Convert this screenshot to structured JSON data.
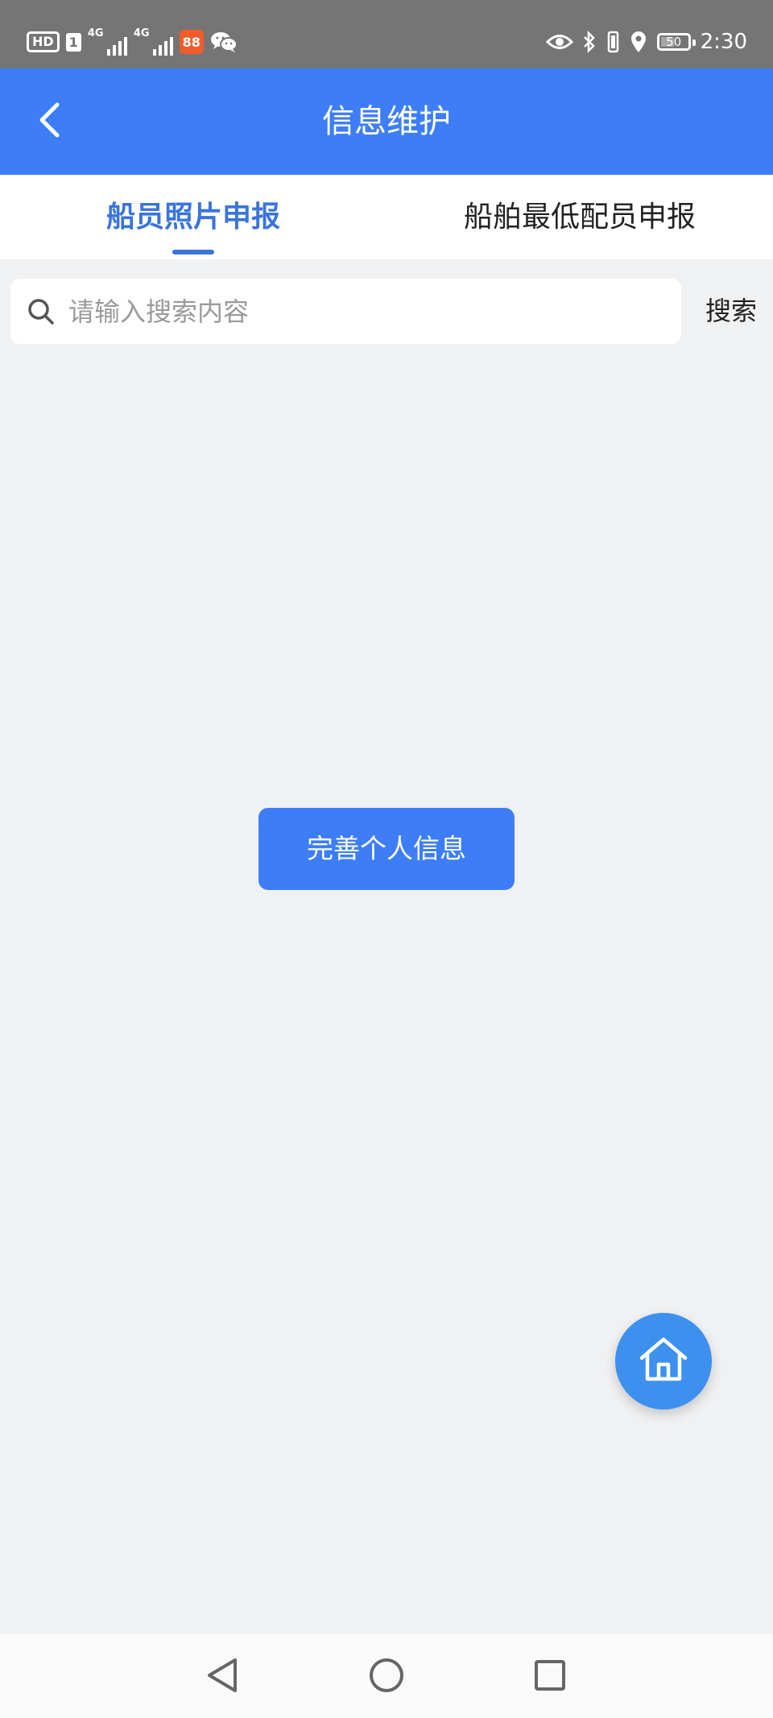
{
  "status_bar": {
    "hd_badge": "HD",
    "sim_badge": "1",
    "network_1": "4G",
    "network_2": "4G",
    "app_badge": "88",
    "battery_level": "50",
    "battery_level_fraction": 0.5,
    "clock": "2:30",
    "icons": [
      "eye-icon",
      "bluetooth-icon",
      "vibrate-icon",
      "location-icon"
    ]
  },
  "header": {
    "title": "信息维护",
    "back_icon": "chevron-left-icon"
  },
  "tabs": [
    {
      "label": "船员照片申报",
      "active": true
    },
    {
      "label": "船舶最低配员申报",
      "active": false
    }
  ],
  "search": {
    "placeholder": "请输入搜索内容",
    "value": "",
    "button_label": "搜索",
    "icon": "search-icon"
  },
  "main": {
    "primary_button_label": "完善个人信息"
  },
  "fab": {
    "icon": "home-icon"
  },
  "nav_bar": {
    "items": [
      "back-triangle-icon",
      "home-circle-icon",
      "recent-square-icon"
    ]
  },
  "colors": {
    "primary": "#3d7ef8",
    "tab_active": "#3a74db",
    "background": "#f0f1f2",
    "fab": "#3d90ee",
    "status_bar": "#757575"
  }
}
